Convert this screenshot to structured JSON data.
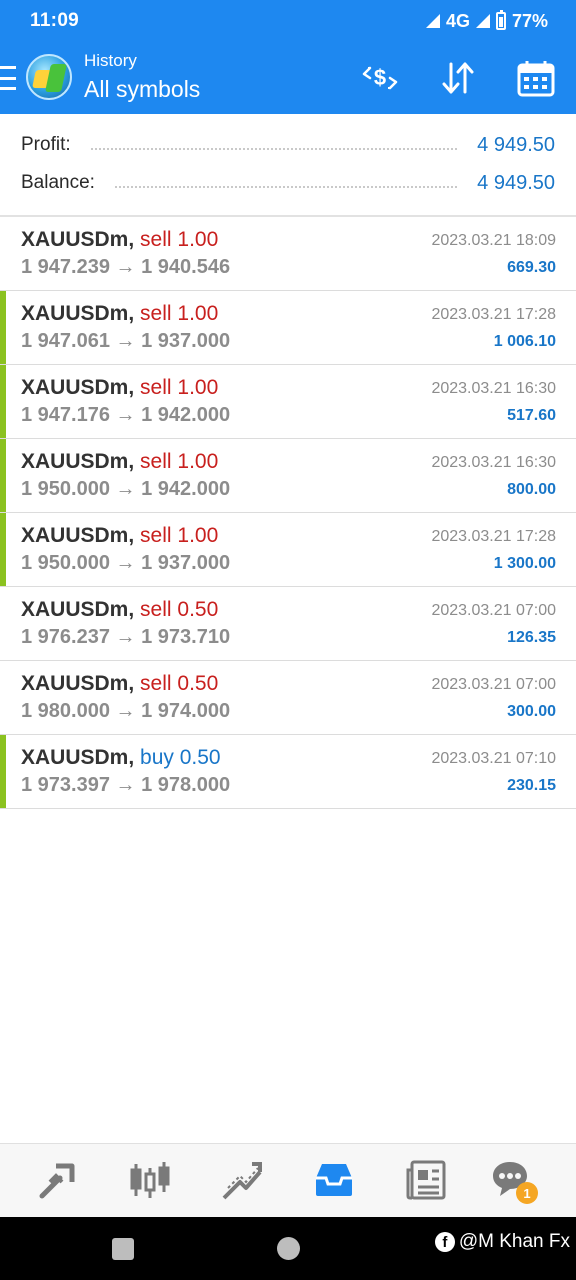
{
  "status_bar": {
    "time": "11:09",
    "network": "4G",
    "battery": "77%"
  },
  "app_bar": {
    "subtitle": "History",
    "title": "All symbols",
    "icons": [
      "menu-icon",
      "metatrader-logo-icon",
      "currency-exchange-icon",
      "sort-icon",
      "calendar-icon"
    ]
  },
  "summary": {
    "profit_label": "Profit:",
    "profit_value": "4 949.50",
    "balance_label": "Balance:",
    "balance_value": "4 949.50"
  },
  "trades": [
    {
      "symbol": "XAUUSDm",
      "type": "sell",
      "volume": "1.00",
      "prices": "1 947.239 → 1 940.546",
      "time": "2023.03.21 18:09",
      "profit": "669.30",
      "marked": false
    },
    {
      "symbol": "XAUUSDm",
      "type": "sell",
      "volume": "1.00",
      "prices": "1 947.061 → 1 937.000",
      "time": "2023.03.21 17:28",
      "profit": "1 006.10",
      "marked": true
    },
    {
      "symbol": "XAUUSDm",
      "type": "sell",
      "volume": "1.00",
      "prices": "1 947.176 → 1 942.000",
      "time": "2023.03.21 16:30",
      "profit": "517.60",
      "marked": true
    },
    {
      "symbol": "XAUUSDm",
      "type": "sell",
      "volume": "1.00",
      "prices": "1 950.000 → 1 942.000",
      "time": "2023.03.21 16:30",
      "profit": "800.00",
      "marked": true
    },
    {
      "symbol": "XAUUSDm",
      "type": "sell",
      "volume": "1.00",
      "prices": "1 950.000 → 1 937.000",
      "time": "2023.03.21 17:28",
      "profit": "1 300.00",
      "marked": true
    },
    {
      "symbol": "XAUUSDm",
      "type": "sell",
      "volume": "0.50",
      "prices": "1 976.237 → 1 973.710",
      "time": "2023.03.21 07:00",
      "profit": "126.35",
      "marked": false
    },
    {
      "symbol": "XAUUSDm",
      "type": "sell",
      "volume": "0.50",
      "prices": "1 980.000 → 1 974.000",
      "time": "2023.03.21 07:00",
      "profit": "300.00",
      "marked": false
    },
    {
      "symbol": "XAUUSDm",
      "type": "buy",
      "volume": "0.50",
      "prices": "1 973.397 → 1 978.000",
      "time": "2023.03.21 07:10",
      "profit": "230.15",
      "marked": true
    }
  ],
  "bottom_nav": {
    "items": [
      "quotes-icon",
      "chart-icon",
      "trade-icon",
      "history-icon",
      "news-icon",
      "chat-icon"
    ],
    "active": "history-icon",
    "chat_badge": "1"
  },
  "watermark": {
    "text": "@M Khan Fx",
    "fb_glyph": "f"
  },
  "colors": {
    "accent": "#1e88f0",
    "sell": "#c8201e",
    "buy": "#1976c8",
    "profit": "#1976c8",
    "marker": "#8bc220"
  }
}
